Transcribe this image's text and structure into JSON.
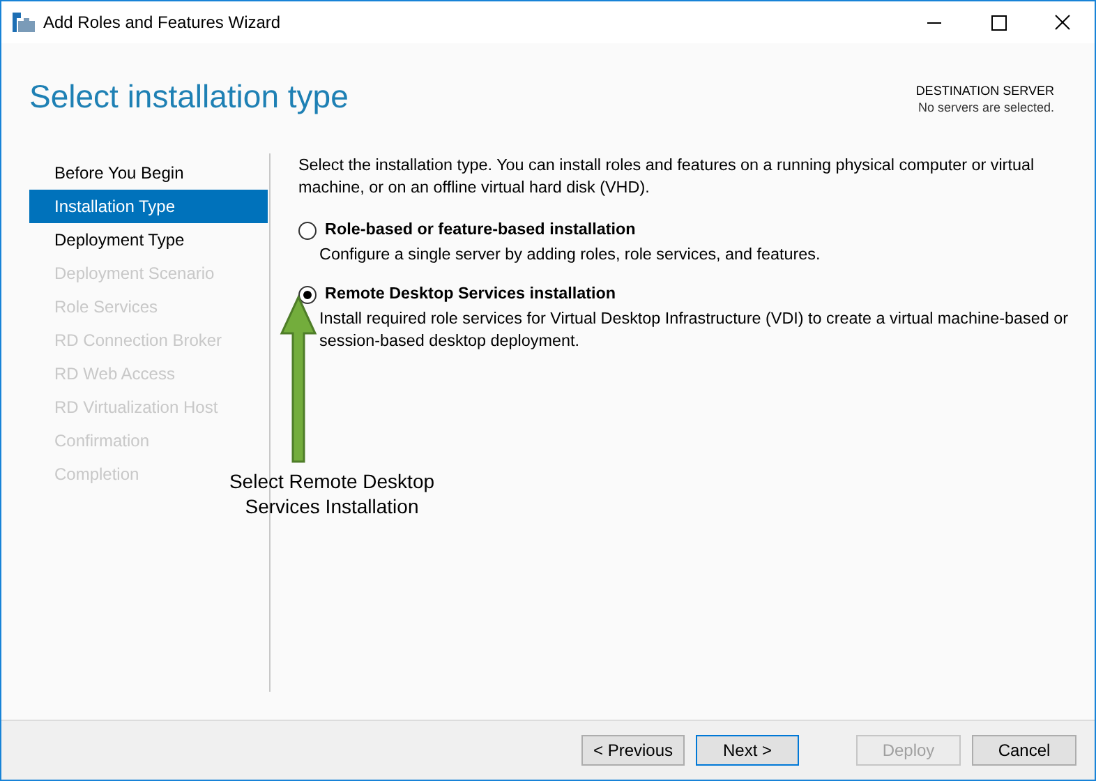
{
  "window": {
    "title": "Add Roles and Features Wizard"
  },
  "header": {
    "title": "Select installation type",
    "server_label": "DESTINATION SERVER",
    "server_value": "No servers are selected."
  },
  "sidebar": {
    "items": [
      {
        "label": "Before You Begin",
        "selected": false,
        "disabled": false
      },
      {
        "label": "Installation Type",
        "selected": true,
        "disabled": false
      },
      {
        "label": "Deployment Type",
        "selected": false,
        "disabled": false
      },
      {
        "label": "Deployment Scenario",
        "selected": false,
        "disabled": true
      },
      {
        "label": "Role Services",
        "selected": false,
        "disabled": true
      },
      {
        "label": "RD Connection Broker",
        "selected": false,
        "disabled": true
      },
      {
        "label": "RD Web Access",
        "selected": false,
        "disabled": true
      },
      {
        "label": "RD Virtualization Host",
        "selected": false,
        "disabled": true
      },
      {
        "label": "Confirmation",
        "selected": false,
        "disabled": true
      },
      {
        "label": "Completion",
        "selected": false,
        "disabled": true
      }
    ]
  },
  "content": {
    "intro": "Select the installation type. You can install roles and features on a running physical computer or virtual machine, or on an offline virtual hard disk (VHD).",
    "options": [
      {
        "label": "Role-based or feature-based installation",
        "description": "Configure a single server by adding roles, role services, and features.",
        "selected": false
      },
      {
        "label": "Remote Desktop Services installation",
        "description": "Install required role services for Virtual Desktop Infrastructure (VDI) to create a virtual machine-based or session-based desktop deployment.",
        "selected": true
      }
    ]
  },
  "annotation": {
    "text": "Select Remote Desktop Services Installation"
  },
  "buttons": [
    {
      "label": "< Previous",
      "disabled": false,
      "focused": false
    },
    {
      "label": "Next >",
      "disabled": false,
      "focused": true
    },
    {
      "label": "Deploy",
      "disabled": true,
      "focused": false
    },
    {
      "label": "Cancel",
      "disabled": false,
      "focused": false
    }
  ]
}
